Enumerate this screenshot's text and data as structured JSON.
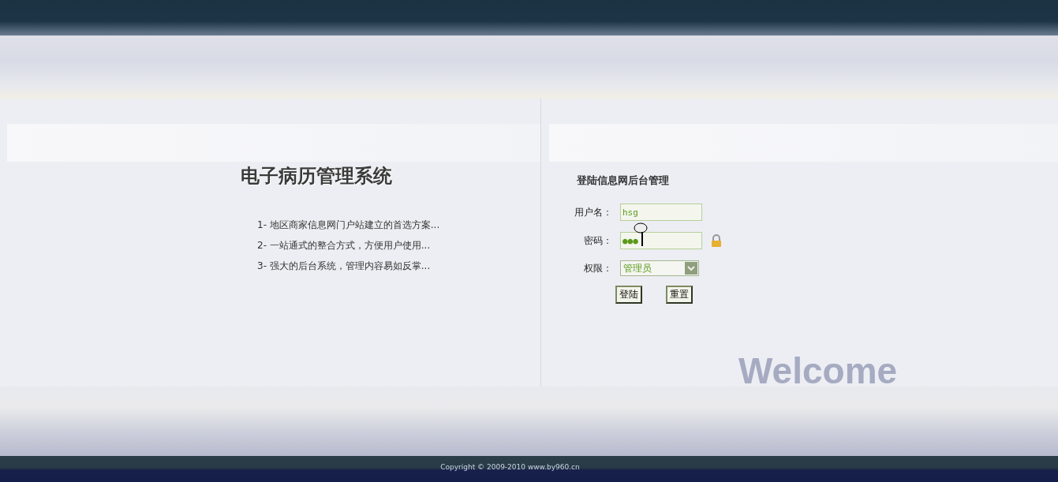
{
  "system_title": "电子病历管理系统",
  "features": [
    "1- 地区商家信息网门户站建立的首选方案...",
    "2- 一站通式的整合方式，方便用户使用...",
    "3- 强大的后台系统，管理内容易如反掌..."
  ],
  "login": {
    "heading": "登陆信息网后台管理",
    "username": {
      "label": "用户名：",
      "value": "hsg"
    },
    "password": {
      "label": "密码：",
      "value": "●●●"
    },
    "role": {
      "label": "权限：",
      "value": "管理员"
    },
    "buttons": [
      "登陆",
      "重置"
    ]
  },
  "watermark": "Welcome",
  "footer": "Copyright © 2009-2010 www.by960.cn"
}
